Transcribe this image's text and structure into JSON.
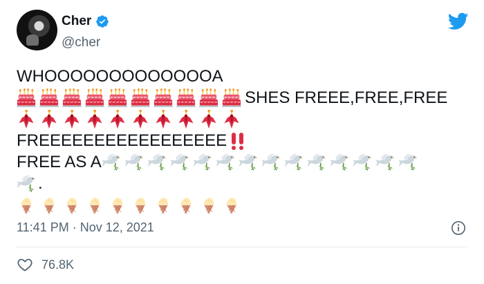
{
  "author": {
    "display_name": "Cher",
    "handle": "@cher",
    "verified": true
  },
  "tweet": {
    "line1": "WHOOOOOOOOOOOOOA",
    "line2_text": "SHES FREEE,FREE,FREE",
    "line4_text": "FREEEEEEEEEEEEEEEEE",
    "line5_text": "FREE AS A",
    "line6_text": ".",
    "emoji": {
      "cake_count": 10,
      "flower_count": 10,
      "dove_count": 15,
      "icecream_count": 10,
      "exclamation": "double-exclamation-icon"
    }
  },
  "meta": {
    "timestamp": "11:41 PM · Nov 12, 2021",
    "likes": "76.8K"
  },
  "colors": {
    "twitter_blue": "#1d9bf0",
    "verified_blue": "#1d9bf0",
    "secondary_text": "#536471"
  }
}
